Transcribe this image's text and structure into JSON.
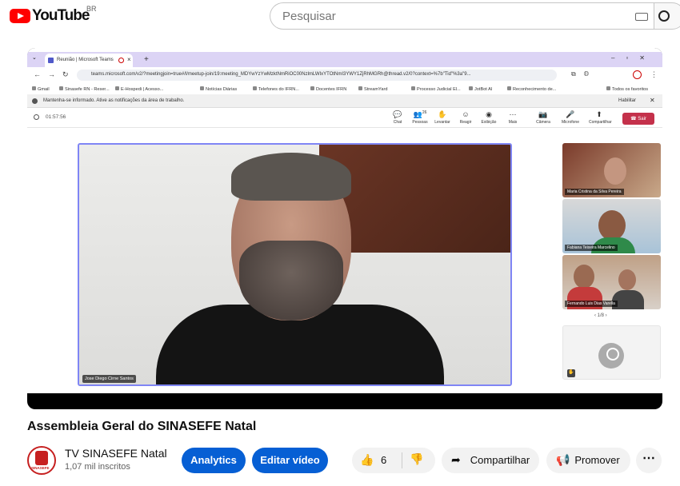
{
  "masthead": {
    "logo_text": "YouTube",
    "country_code": "BR",
    "search_placeholder": "Pesquisar"
  },
  "browser": {
    "tab_title": "Reunião | Microsoft Teams",
    "url": "teams.microsoft.com/v2/?meetingjoin=true#/l/meetup-join/19:meeting_MDYwYzYwMzktNmRiOC00NzlmLWIxYTOtNmI3YWY1ZjRhMGRh@thread.v2/0?context=%7b\"Tid\"%3a\"9...",
    "bookmarks": [
      "Gmail",
      "Sinasefe RN - Reser...",
      "E-Hospedi | Acesso...",
      "Notícias Diárias",
      "Telefones do IFRN...",
      "Docentes IFRN",
      "StreamYard",
      "Processo Judicial El...",
      "JotBot AI",
      "Reconhecimento de...",
      "Todos os favoritos"
    ],
    "notification": "Mantenha-se informado. Ative as notificações da área de trabalho.",
    "notification_action": "Habilitar"
  },
  "teams": {
    "timer": "01:57:56",
    "toolbar": [
      {
        "icon": "chat-icon",
        "label": "Chat",
        "glyph": "💬"
      },
      {
        "icon": "people-icon",
        "label": "Pessoas",
        "glyph": "👥",
        "badge": "26"
      },
      {
        "icon": "raise-hand-icon",
        "label": "Levantar",
        "glyph": "✋"
      },
      {
        "icon": "react-icon",
        "label": "Reagir",
        "glyph": "☺"
      },
      {
        "icon": "view-icon",
        "label": "Exibição",
        "glyph": "◉"
      },
      {
        "icon": "more-icon",
        "label": "Mais",
        "glyph": "⋯"
      },
      {
        "icon": "camera-icon",
        "label": "Câmera",
        "glyph": "📷"
      },
      {
        "icon": "microphone-icon",
        "label": "Microfone",
        "glyph": "🎤"
      },
      {
        "icon": "share-icon",
        "label": "Compartilhar",
        "glyph": "⬆"
      }
    ],
    "leave_label": "Sair",
    "main_speaker": "Jose Diego Cirne Santos",
    "participants": [
      "Maria Cristina da Silva Pereira",
      "Fabiana Teixeira Marcelino",
      "Fernando Luis Dias Varella"
    ],
    "pager": "1/8"
  },
  "video": {
    "title": "Assembleia Geral do SINASEFE Natal",
    "channel_name": "TV SINASEFE Natal",
    "subscribers": "1,07 mil inscritos",
    "channel_logo_text": "SINASEFE",
    "analytics_label": "Analytics",
    "edit_label": "Editar vídeo",
    "likes": "6",
    "share_label": "Compartilhar",
    "promote_label": "Promover"
  }
}
